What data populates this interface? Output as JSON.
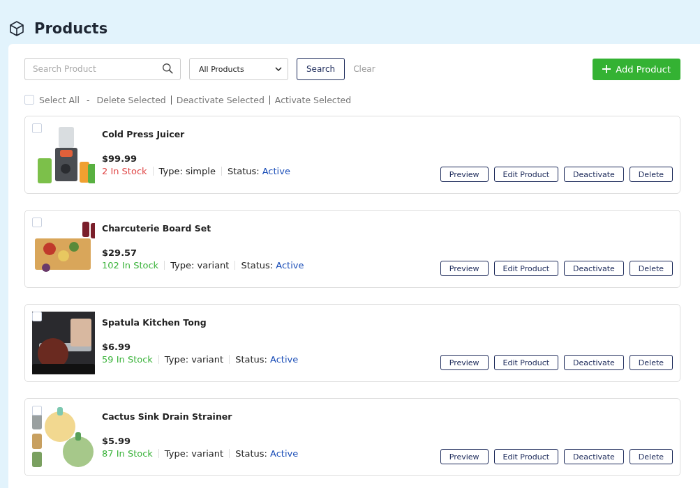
{
  "page": {
    "title": "Products"
  },
  "toolbar": {
    "search": {
      "placeholder": "Search Product"
    },
    "filter": {
      "value": "All Products"
    },
    "search_button": "Search",
    "clear_button": "Clear",
    "add_button": "Add Product"
  },
  "bulk": {
    "select_all": {
      "label": "Select All",
      "checked": false
    },
    "separator": "-",
    "actions": [
      "Delete Selected",
      "Deactivate Selected",
      "Activate Selected"
    ]
  },
  "products": [
    {
      "name": "Cold Press Juicer",
      "price": "$99.99",
      "stock": "2 In Stock",
      "low_stock": true,
      "type": "Type: simple",
      "status_label": "Status:",
      "status": "Active",
      "checked": false,
      "actions": [
        "Preview",
        "Edit Product",
        "Deactivate",
        "Delete"
      ]
    },
    {
      "name": "Charcuterie Board Set",
      "price": "$29.57",
      "stock": "102 In Stock",
      "low_stock": false,
      "type": "Type: variant",
      "status_label": "Status:",
      "status": "Active",
      "checked": false,
      "actions": [
        "Preview",
        "Edit Product",
        "Deactivate",
        "Delete"
      ]
    },
    {
      "name": "Spatula Kitchen Tong",
      "price": "$6.99",
      "stock": "59 In Stock",
      "low_stock": false,
      "type": "Type: variant",
      "status_label": "Status:",
      "status": "Active",
      "checked": false,
      "actions": [
        "Preview",
        "Edit Product",
        "Deactivate",
        "Delete"
      ]
    },
    {
      "name": "Cactus Sink Drain Strainer",
      "price": "$5.99",
      "stock": "87 In Stock",
      "low_stock": false,
      "type": "Type: variant",
      "status_label": "Status:",
      "status": "Active",
      "checked": false,
      "actions": [
        "Preview",
        "Edit Product",
        "Deactivate",
        "Delete"
      ]
    }
  ]
}
